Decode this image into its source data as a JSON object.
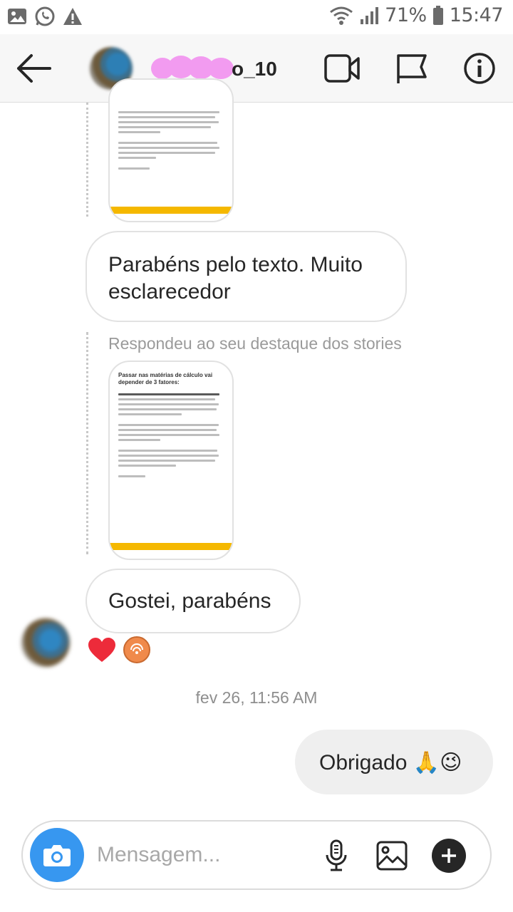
{
  "status_bar": {
    "battery": "71%",
    "time": "15:47"
  },
  "header": {
    "username": "o_10"
  },
  "story_preview_1": {
    "label": "@engenheiro.curioso_",
    "page": "3/3"
  },
  "story_preview_2": {
    "title": "Passar nas matérias de cálculo vai depender de 3 fatores:",
    "label": "@engenheiro.curioso_",
    "page": "2/2"
  },
  "messages": {
    "incoming_1": "Parabéns pelo texto. Muito esclarecedor",
    "reply_note": "Respondeu ao seu destaque dos stories",
    "incoming_2": "Gostei, parabéns",
    "timestamp": "fev 26, 11:56 AM",
    "outgoing_1": "Obrigado 🙏😉"
  },
  "reactions": [
    "heart",
    "sticker"
  ],
  "composer": {
    "placeholder": "Mensagem..."
  },
  "colors": {
    "accent": "#3797f0",
    "reaction_heart": "#ed2b3a",
    "story_bar": "#f5b800",
    "redaction_blob": "#f29bf0"
  }
}
